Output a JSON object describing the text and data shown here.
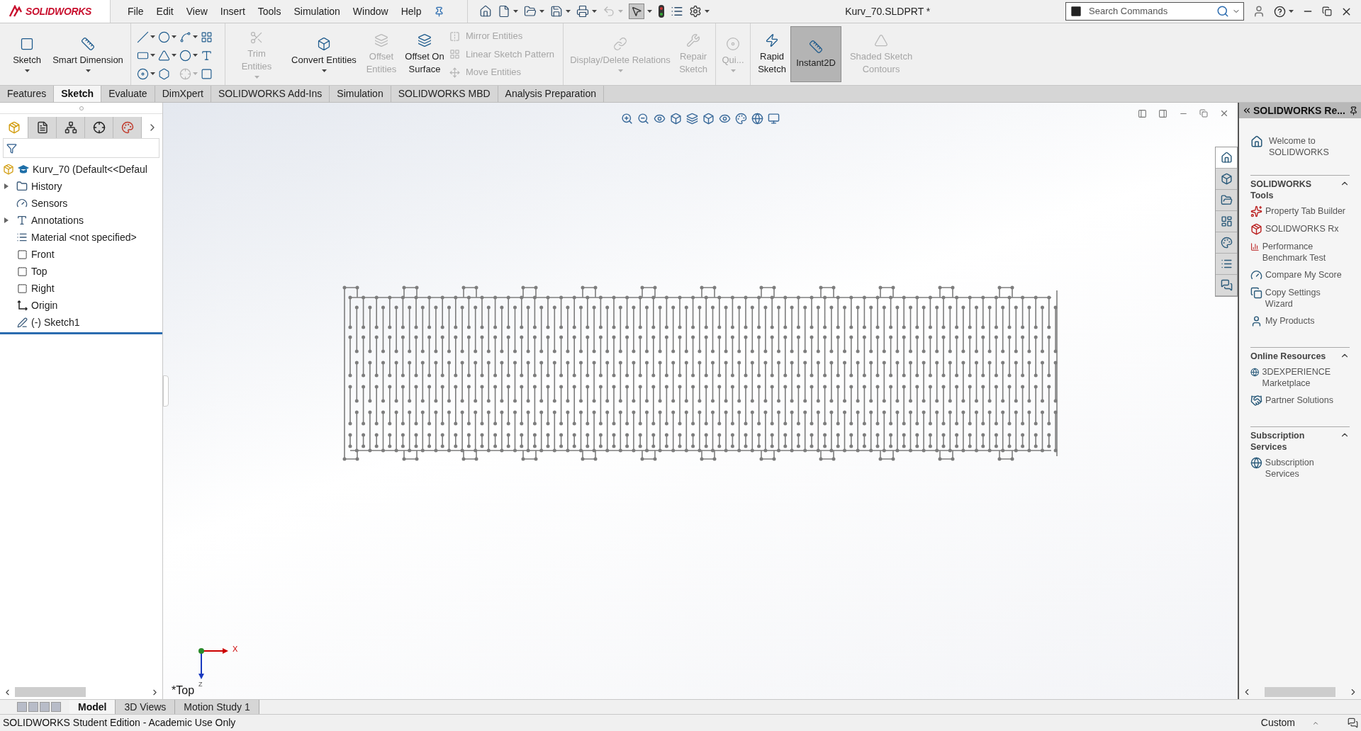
{
  "app": {
    "logo": "SOLIDWORKS",
    "menu": [
      "File",
      "Edit",
      "View",
      "Insert",
      "Tools",
      "Simulation",
      "Window",
      "Help"
    ],
    "document_title": "Kurv_70.SLDPRT *",
    "search": {
      "placeholder": "Search Commands"
    }
  },
  "ribbon": [
    {
      "kind": "buttons",
      "items": [
        {
          "kind": "large",
          "label": "Sketch",
          "disabled": false,
          "pressed": false,
          "dropdown": true
        },
        {
          "kind": "large",
          "label": "Smart Dimension",
          "disabled": false,
          "pressed": false,
          "dropdown": true
        }
      ]
    },
    {
      "kind": "tool_grid"
    },
    {
      "kind": "buttons",
      "items": [
        {
          "kind": "large",
          "label": "Trim Entities",
          "disabled": true,
          "pressed": false,
          "dropdown": true
        },
        {
          "kind": "large",
          "label": "Convert Entities",
          "disabled": false,
          "pressed": false,
          "dropdown": true
        },
        {
          "kind": "large",
          "label": "Offset Entities",
          "disabled": true,
          "pressed": false,
          "dropdown": false
        },
        {
          "kind": "large",
          "label": "Offset On Surface",
          "disabled": false,
          "pressed": false,
          "dropdown": false
        },
        {
          "kind": "stack",
          "entries": [
            {
              "label": "Mirror Entities",
              "disabled": true
            },
            {
              "label": "Linear Sketch Pattern",
              "disabled": true
            },
            {
              "label": "Move Entities",
              "disabled": true
            }
          ]
        }
      ]
    },
    {
      "kind": "buttons",
      "items": [
        {
          "kind": "large",
          "label": "Display/Delete Relations",
          "disabled": true,
          "pressed": false,
          "dropdown": true
        },
        {
          "kind": "large",
          "label": "Repair Sketch",
          "disabled": true,
          "pressed": false,
          "dropdown": false
        }
      ]
    },
    {
      "kind": "buttons",
      "items": [
        {
          "kind": "large",
          "label": "Qui...",
          "disabled": true,
          "pressed": false,
          "dropdown": true
        }
      ]
    },
    {
      "kind": "buttons",
      "items": [
        {
          "kind": "large",
          "label": "Rapid Sketch",
          "disabled": false,
          "pressed": false,
          "dropdown": false
        },
        {
          "kind": "large",
          "label": "Instant2D",
          "disabled": false,
          "pressed": true,
          "dropdown": false
        },
        {
          "kind": "large",
          "label": "Shaded Sketch Contours",
          "disabled": true,
          "pressed": false,
          "dropdown": false
        }
      ]
    }
  ],
  "command_tabs": [
    {
      "label": "Features",
      "selected": false
    },
    {
      "label": "Sketch",
      "selected": true
    },
    {
      "label": "Evaluate",
      "selected": false
    },
    {
      "label": "DimXpert",
      "selected": false
    },
    {
      "label": "SOLIDWORKS Add-Ins",
      "selected": false
    },
    {
      "label": "Simulation",
      "selected": false
    },
    {
      "label": "SOLIDWORKS MBD",
      "selected": false
    },
    {
      "label": "Analysis Preparation",
      "selected": false
    }
  ],
  "left_panel_tabs": [
    {
      "selected": true
    },
    {
      "selected": false
    },
    {
      "selected": false
    },
    {
      "selected": false
    },
    {
      "selected": false
    }
  ],
  "feature_tree": {
    "root": "Kurv_70  (Default<<Defaul",
    "items": [
      {
        "label": "History",
        "expandable": true
      },
      {
        "label": "Sensors",
        "expandable": false
      },
      {
        "label": "Annotations",
        "expandable": true
      },
      {
        "label": "Material <not specified>",
        "expandable": false
      },
      {
        "label": "Front",
        "expandable": false
      },
      {
        "label": "Top",
        "expandable": false
      },
      {
        "label": "Right",
        "expandable": false
      },
      {
        "label": "Origin",
        "expandable": false
      },
      {
        "label": "(-) Sketch1",
        "expandable": false
      }
    ]
  },
  "viewport": {
    "view_name": "*Top",
    "triad": {
      "x_label": "X",
      "z_label": "Z"
    }
  },
  "task_pane": {
    "title": "SOLIDWORKS Re...",
    "side_tabs": [
      {
        "selected": true
      },
      {
        "selected": false
      },
      {
        "selected": false
      },
      {
        "selected": false
      },
      {
        "selected": false
      },
      {
        "selected": false
      },
      {
        "selected": false
      }
    ],
    "welcome": "Welcome to SOLIDWORKS",
    "sections": [
      {
        "title": "SOLIDWORKS Tools",
        "expanded": true,
        "items": [
          "Property Tab Builder",
          "SOLIDWORKS Rx",
          "Performance Benchmark Test",
          "Compare My Score",
          "Copy Settings Wizard",
          "My Products"
        ]
      },
      {
        "title": "Online Resources",
        "expanded": true,
        "items": [
          "3DEXPERIENCE Marketplace",
          "Partner Solutions"
        ]
      },
      {
        "title": "Subscription Services",
        "expanded": true,
        "items": [
          "Subscription Services"
        ]
      }
    ]
  },
  "bottom_tabs": [
    {
      "label": "Model",
      "selected": true
    },
    {
      "label": "3D Views",
      "selected": false
    },
    {
      "label": "Motion Study 1",
      "selected": false
    }
  ],
  "status_bar": {
    "text": "SOLIDWORKS Student Edition - Academic Use Only",
    "units": "Custom"
  }
}
